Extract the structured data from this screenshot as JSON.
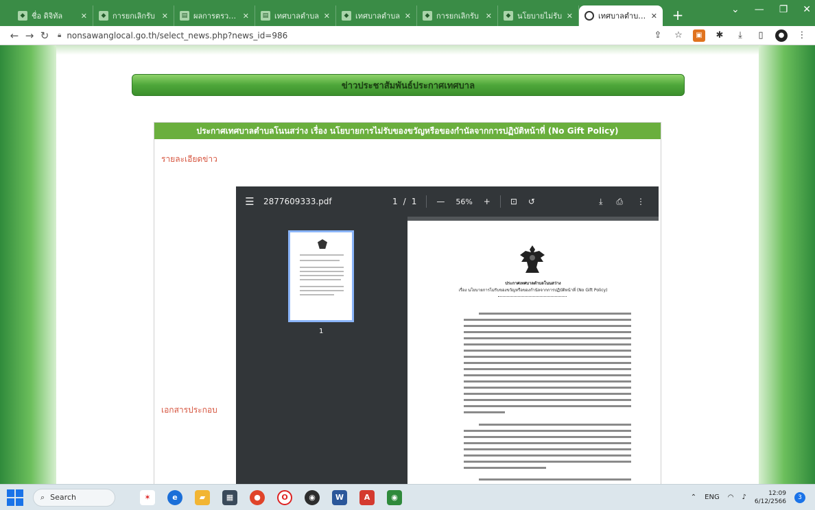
{
  "browser": {
    "tabs": [
      {
        "title": "ชื่อ ดิจิทัล"
      },
      {
        "title": "การยกเลิกรับ"
      },
      {
        "title": "ผลการตรวจสอบ"
      },
      {
        "title": "เทศบาลตำบล"
      },
      {
        "title": "เทศบาลตำบล"
      },
      {
        "title": "การยกเลิกรับ"
      },
      {
        "title": "นโยบายไม่รับ"
      }
    ],
    "active_tab": {
      "title": "เทศบาลตำบลโน"
    },
    "new_tab_label": "+",
    "address": "nonsawanglocal.go.th/select_news.php?news_id=986"
  },
  "page": {
    "section_header": "ข่าวประชาสัมพันธ์ประกาศเทศบาล",
    "article_title": "ประกาศเทศบาลตำบลโนนสว่าง เรื่อง นโยบายการไม่รับของขวัญหรือของกำนัลจากการปฏิบัติหน้าที่ (No Gift Policy)",
    "detail_label": "รายละเอียดข่าว",
    "attachments_label": "เอกสารประกอบ"
  },
  "pdf": {
    "filename": "2877609333.pdf",
    "current_page": "1",
    "page_sep": "/",
    "total_pages": "1",
    "zoom": "56%",
    "thumbnail_number": "1",
    "doc_issuer": "ประกาศเทศบาลตำบลโนนสว่าง",
    "doc_subject": "เรื่อง นโยบายการไม่รับของขวัญหรือของกำนัลจากการปฏิบัติหน้าที่ (No Gift Policy)"
  },
  "taskbar": {
    "search_label": "Search",
    "language": "ENG",
    "time": "12:09",
    "date": "6/12/2566",
    "notification_count": "3"
  },
  "colors": {
    "site_green": "#3b8f2c",
    "accent_red": "#d6553f",
    "pdf_toolbar": "#323639"
  }
}
